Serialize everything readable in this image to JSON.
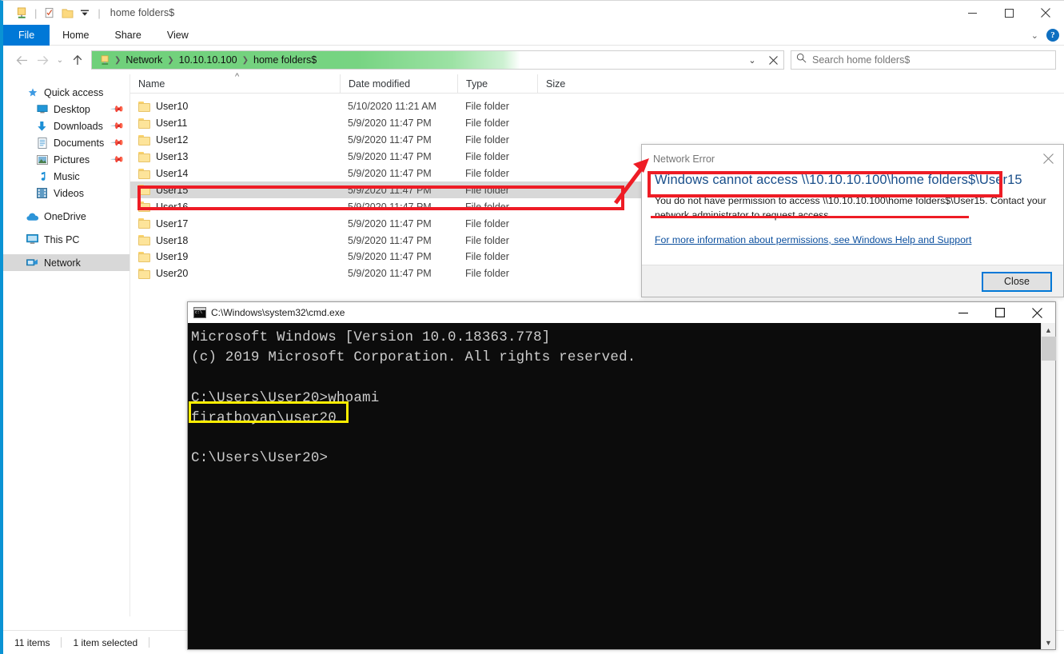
{
  "explorer": {
    "window_title": "home folders$",
    "quick_access_toolbar": [
      {
        "name": "folder-properties-icon",
        "label": "Properties"
      },
      {
        "name": "new-folder-icon",
        "label": "New folder"
      },
      {
        "name": "customize-dropdown-icon",
        "label": "Customize Quick Access Toolbar"
      }
    ],
    "window_controls": {
      "minimize": "Minimize",
      "maximize": "Maximize",
      "close": "Close"
    },
    "ribbon": {
      "tabs": [
        {
          "label": "File",
          "active": true
        },
        {
          "label": "Home",
          "active": false
        },
        {
          "label": "Share",
          "active": false
        },
        {
          "label": "View",
          "active": false
        }
      ],
      "collapse_label": "Minimize the Ribbon",
      "help_label": "?"
    },
    "navigation": {
      "back_label": "Back",
      "forward_label": "Forward",
      "recent_label": "Recent locations",
      "up_label": "Up",
      "breadcrumbs": [
        "Network",
        "10.10.10.100",
        "home folders$"
      ],
      "history_label": "Previous locations",
      "stop_label": "Stop",
      "loading_percent": 62
    },
    "search": {
      "placeholder": "Search home folders$",
      "value": ""
    },
    "nav_pane": [
      {
        "label": "Quick access",
        "icon": "star-pin-icon",
        "level": 0,
        "pinned": false,
        "selected": false
      },
      {
        "label": "Desktop",
        "icon": "desktop-icon",
        "level": 1,
        "pinned": true,
        "selected": false
      },
      {
        "label": "Downloads",
        "icon": "download-arrow-icon",
        "level": 1,
        "pinned": true,
        "selected": false
      },
      {
        "label": "Documents",
        "icon": "document-icon",
        "level": 1,
        "pinned": true,
        "selected": false
      },
      {
        "label": "Pictures",
        "icon": "picture-icon",
        "level": 1,
        "pinned": true,
        "selected": false
      },
      {
        "label": "Music",
        "icon": "music-note-icon",
        "level": 1,
        "pinned": false,
        "selected": false
      },
      {
        "label": "Videos",
        "icon": "video-film-icon",
        "level": 1,
        "pinned": false,
        "selected": false
      },
      {
        "label": "OneDrive",
        "icon": "cloud-icon",
        "level": 0,
        "pinned": false,
        "selected": false
      },
      {
        "label": "This PC",
        "icon": "computer-icon",
        "level": 0,
        "pinned": false,
        "selected": false
      },
      {
        "label": "Network",
        "icon": "network-icon",
        "level": 0,
        "pinned": false,
        "selected": true
      }
    ],
    "columns": [
      {
        "key": "name",
        "label": "Name",
        "sort": "asc"
      },
      {
        "key": "date",
        "label": "Date modified",
        "sort": null
      },
      {
        "key": "type",
        "label": "Type",
        "sort": null
      },
      {
        "key": "size",
        "label": "Size",
        "sort": null
      }
    ],
    "files": [
      {
        "name": "User10",
        "date": "5/10/2020 11:21 AM",
        "type": "File folder",
        "size": "",
        "selected": false
      },
      {
        "name": "User11",
        "date": "5/9/2020 11:47 PM",
        "type": "File folder",
        "size": "",
        "selected": false
      },
      {
        "name": "User12",
        "date": "5/9/2020 11:47 PM",
        "type": "File folder",
        "size": "",
        "selected": false
      },
      {
        "name": "User13",
        "date": "5/9/2020 11:47 PM",
        "type": "File folder",
        "size": "",
        "selected": false
      },
      {
        "name": "User14",
        "date": "5/9/2020 11:47 PM",
        "type": "File folder",
        "size": "",
        "selected": false
      },
      {
        "name": "User15",
        "date": "5/9/2020 11:47 PM",
        "type": "File folder",
        "size": "",
        "selected": true
      },
      {
        "name": "User16",
        "date": "5/9/2020 11:47 PM",
        "type": "File folder",
        "size": "",
        "selected": false
      },
      {
        "name": "User17",
        "date": "5/9/2020 11:47 PM",
        "type": "File folder",
        "size": "",
        "selected": false
      },
      {
        "name": "User18",
        "date": "5/9/2020 11:47 PM",
        "type": "File folder",
        "size": "",
        "selected": false
      },
      {
        "name": "User19",
        "date": "5/9/2020 11:47 PM",
        "type": "File folder",
        "size": "",
        "selected": false
      },
      {
        "name": "User20",
        "date": "5/9/2020 11:47 PM",
        "type": "File folder",
        "size": "",
        "selected": false
      }
    ],
    "status_bar": {
      "item_count": "11 items",
      "selection": "1 item selected"
    }
  },
  "dialog": {
    "title": "Network Error",
    "close_icon_label": "Close",
    "heading": "Windows cannot access \\\\10.10.10.100\\home folders$\\User15",
    "body": "You do not have permission to access \\\\10.10.10.100\\home folders$\\User15. Contact your network administrator to request access.",
    "link": "For more information about permissions, see Windows Help and Support",
    "button_close": "Close"
  },
  "cmd": {
    "title": "C:\\Windows\\system32\\cmd.exe",
    "window_controls": {
      "minimize": "Minimize",
      "maximize": "Maximize",
      "close": "Close"
    },
    "lines": [
      "Microsoft Windows [Version 10.0.18363.778]",
      "(c) 2019 Microsoft Corporation. All rights reserved.",
      "",
      "C:\\Users\\User20>whoami",
      "firatboyan\\user20",
      "",
      "C:\\Users\\User20>"
    ],
    "highlighted_output": "firatboyan\\user20"
  },
  "annotations": {
    "box_color": "#ee1c25",
    "highlight_color": "#ffee00",
    "arrow_label": "points-from-selected-folder-to-error-dialog"
  },
  "colors": {
    "accent_blue": "#0078d7",
    "window_border_blue": "#0a93d4",
    "progress_green": "#6fd07a",
    "selection_gray": "#d8d8d8",
    "dialog_heading_blue": "#1a4f8a",
    "cmd_background": "#0c0c0c",
    "cmd_text": "#cccccc"
  }
}
